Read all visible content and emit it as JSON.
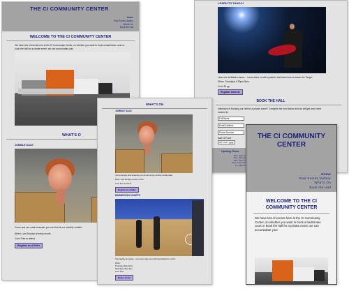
{
  "s1": {
    "title": "THE CI COMMUNITY CENTER",
    "nav": [
      "Home",
      "Past Events Gallery",
      "What's On",
      "Book the Hall"
    ],
    "welcome": "WELCOME TO THE CI COMMUNITY CENTER",
    "intro": "We have lots of events here at the CI Community Center, so whether you want to book a badminton court or book the hall for a private event, we can accomodate you!",
    "whats_on": "WHAT'S O",
    "jumble": "JUMBLE SALE",
    "caption": "Come and see what treasures you can find at our monthly Jumble",
    "when": "When: Last Sunday of every month",
    "cost": "Cost: Free to attend",
    "button": "Register as a Seller"
  },
  "s2": {
    "whats_on": "WHAT'S ON",
    "jumble": "JUMBLE SALE",
    "caption": "Come and see what treasures you can find at our monthly Jumble Sale!",
    "when": "When: Last Sunday of every month",
    "cost": "Cost: Free to attend",
    "button": "Register as a Seller",
    "badminton": "BADMINTON COURTS",
    "bad_caption": "Stay healthy and active - come and make use of the free badminton courts!",
    "bad_when": "When:",
    "bad_when2": "Thursdays 6pm-10pm",
    "bad_when3": "Saturdays 10am-4pm",
    "bad_cost": "Cost: Free",
    "bad_button": "Book a Court"
  },
  "s3": {
    "tango": "LEARN TO TANGO!",
    "tango_caption": "Learn the forbidden dance... come alone or with a partner and learn how to dance the Tango!",
    "when": "When: Tuesday's 6:30pm-8pm",
    "cost": "Cost: £5 pp",
    "button": "Register Interest",
    "book": "BOOK THE HALL",
    "book_intro": "Interested in Booking our hall for a private event? Complete the form below and we will get your event booked in!",
    "fields": [
      "Full Name",
      "Email Address",
      "Phone Number",
      "Date of Event"
    ],
    "date_placeholder": "dd / mm / yyyy",
    "opening": "Opening Times",
    "times": [
      "Mon: 10am-7pm",
      "Tues: 10am-8pm",
      "Wed: 10am-7pm",
      "Thurs: 10am-10pm",
      "Fri: 10am-7pm"
    ]
  },
  "s4": {
    "title": "THE CI COMMUNITY CENTER",
    "nav": [
      "Home",
      "Past Events Gallery",
      "What's On",
      "Book the Hall"
    ],
    "welcome": "WELCOME TO THE CI COMMUNITY CENTER",
    "intro": "We have lots of events here at the CI Community Center, so whether you want to book a badminton court or book the hall for a private event, we can accomodate you!"
  }
}
